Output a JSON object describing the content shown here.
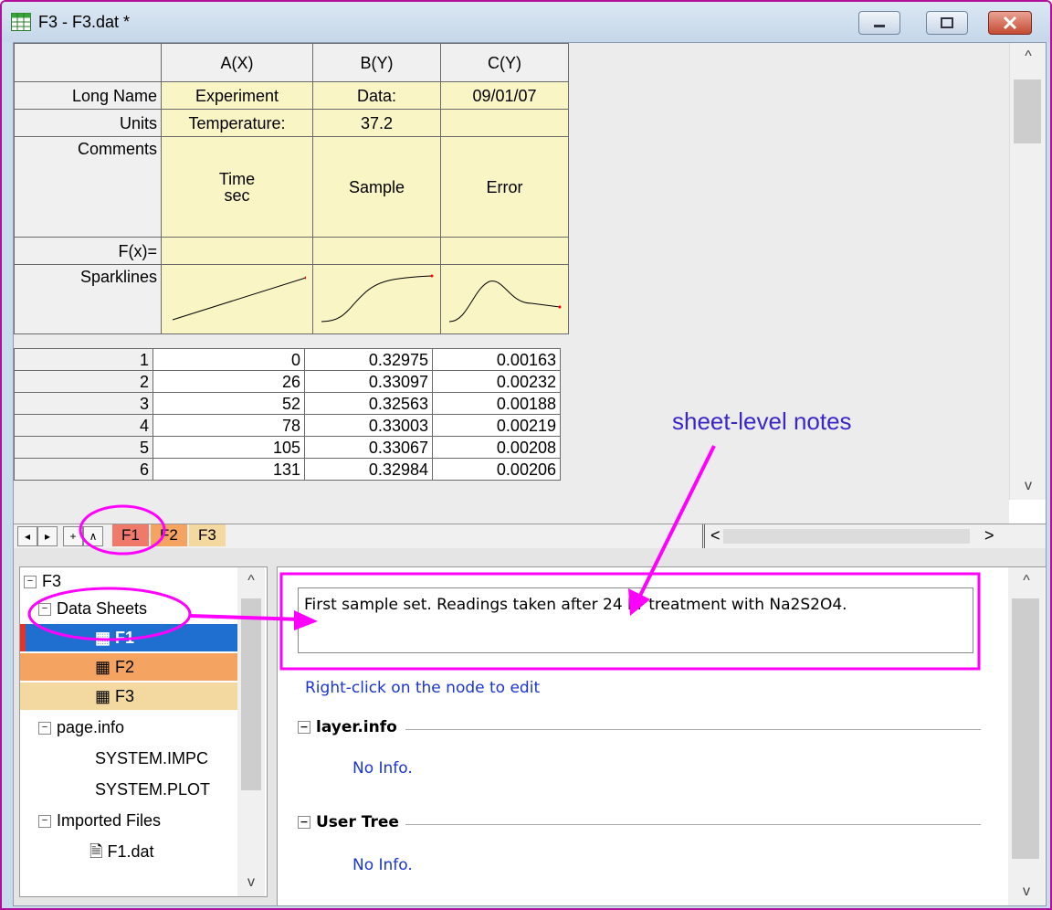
{
  "window": {
    "title": "F3 - F3.dat *"
  },
  "worksheet": {
    "columns": [
      "A(X)",
      "B(Y)",
      "C(Y)"
    ],
    "label_rows": {
      "long_name": {
        "label": "Long Name",
        "values": [
          "Experiment",
          "Data:",
          "09/01/07"
        ]
      },
      "units": {
        "label": "Units",
        "values": [
          "Temperature:",
          "37.2",
          ""
        ]
      },
      "comments": {
        "label": "Comments",
        "values": [
          [
            "Time",
            "sec"
          ],
          [
            "Sample"
          ],
          [
            "Error"
          ]
        ]
      },
      "fx": {
        "label": "F(x)="
      },
      "sparklines": {
        "label": "Sparklines"
      }
    },
    "rows": [
      {
        "n": "1",
        "a": "0",
        "b": "0.32975",
        "c": "0.00163"
      },
      {
        "n": "2",
        "a": "26",
        "b": "0.33097",
        "c": "0.00232"
      },
      {
        "n": "3",
        "a": "52",
        "b": "0.32563",
        "c": "0.00188"
      },
      {
        "n": "4",
        "a": "78",
        "b": "0.33003",
        "c": "0.00219"
      },
      {
        "n": "5",
        "a": "105",
        "b": "0.33067",
        "c": "0.00208"
      },
      {
        "n": "6",
        "a": "131",
        "b": "0.32984",
        "c": "0.00206"
      }
    ],
    "sheet_tabs": [
      {
        "label": "F1",
        "color": "#f07a6a"
      },
      {
        "label": "F2",
        "color": "#f4a460"
      },
      {
        "label": "F3",
        "color": "#f3d9a0"
      }
    ],
    "nav_buttons": [
      "◂",
      "▸",
      "+",
      "∧"
    ],
    "scroll_arrows": {
      "up": "^",
      "down": "v",
      "left": "<",
      "right": ">"
    }
  },
  "organizer": {
    "tree": {
      "root": "F3",
      "data_sheets": "Data Sheets",
      "sheets": [
        "F1",
        "F2",
        "F3"
      ],
      "page_info": "page.info",
      "page_info_items": [
        "SYSTEM.IMPC",
        "SYSTEM.PLOT"
      ],
      "imported_files": "Imported Files",
      "imported_items": [
        "F1.dat"
      ]
    },
    "notes": {
      "text": "First sample set. Readings taken after 24 hr treatment with Na2S2O4.",
      "hint": "Right-click on the node to edit"
    },
    "sections": [
      {
        "title": "layer.info",
        "body": "No Info."
      },
      {
        "title": "User Tree",
        "body": "No Info."
      }
    ]
  },
  "annotations": {
    "sheet_notes_label": "sheet-level notes"
  },
  "colors": {
    "annotation": "#ff00ff",
    "highlight_f1": "#1f6fd0",
    "highlight_f2": "#f4a460",
    "highlight_f3": "#f3d9a0",
    "label_row_bg": "#f9f5c4"
  },
  "icons": [
    "worksheet-icon",
    "minimize-icon",
    "maximize-icon",
    "close-icon",
    "file-icon"
  ]
}
